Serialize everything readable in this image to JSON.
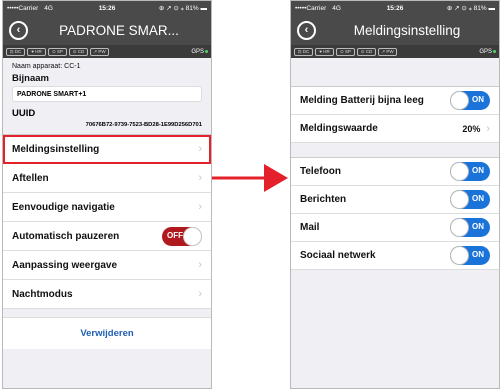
{
  "left": {
    "status": {
      "carrier": "•••••Carrier",
      "network": "4G",
      "time": "15:26",
      "right": "⊕ ↗ ⊙ ⁎ 81% ▬"
    },
    "nav": {
      "title": "PADRONE SMAR..."
    },
    "sensors": [
      "⊡ DC",
      "♥ HR",
      "⊙ SP",
      "⊙ CD",
      "↗ PW"
    ],
    "gps": "GPS",
    "info": {
      "device_name": "Naam apparaat:  CC-1",
      "nickname_label": "Bijnaam",
      "nickname_value": "PADRONE SMART+1",
      "uuid_label": "UUID",
      "uuid_value": "70676B72-9739-7523-BD28-1E99D256D701"
    },
    "rows": [
      {
        "label": "Meldingsinstelling",
        "type": "link"
      },
      {
        "label": "Aftellen",
        "type": "link"
      },
      {
        "label": "Eenvoudige navigatie",
        "type": "link"
      },
      {
        "label": "Automatisch pauzeren",
        "type": "toggle",
        "state": "OFF"
      },
      {
        "label": "Aanpassing weergave",
        "type": "link"
      },
      {
        "label": "Nachtmodus",
        "type": "link"
      }
    ],
    "delete_label": "Verwijderen"
  },
  "right": {
    "status": {
      "carrier": "•••••Carrier",
      "network": "4G",
      "time": "15:26",
      "right": "⊕ ↗ ⊙ ⁎ 81% ▬"
    },
    "nav": {
      "title": "Meldingsinstelling"
    },
    "sensors": [
      "⊡ DC",
      "♥ HR",
      "⊙ SP",
      "⊙ CD",
      "↗ PW"
    ],
    "gps": "GPS",
    "battery_row": {
      "label": "Melding Batterij bijna leeg",
      "state": "ON"
    },
    "value_row": {
      "label": "Meldingswaarde",
      "value": "20%"
    },
    "notif_rows": [
      {
        "label": "Telefoon",
        "state": "ON"
      },
      {
        "label": "Berichten",
        "state": "ON"
      },
      {
        "label": "Mail",
        "state": "ON"
      },
      {
        "label": "Sociaal netwerk",
        "state": "ON"
      }
    ]
  },
  "colors": {
    "highlight": "#e4212b",
    "toggle_on": "#1a73d9",
    "toggle_off": "#b01a1e",
    "header": "#4a4a4a"
  }
}
